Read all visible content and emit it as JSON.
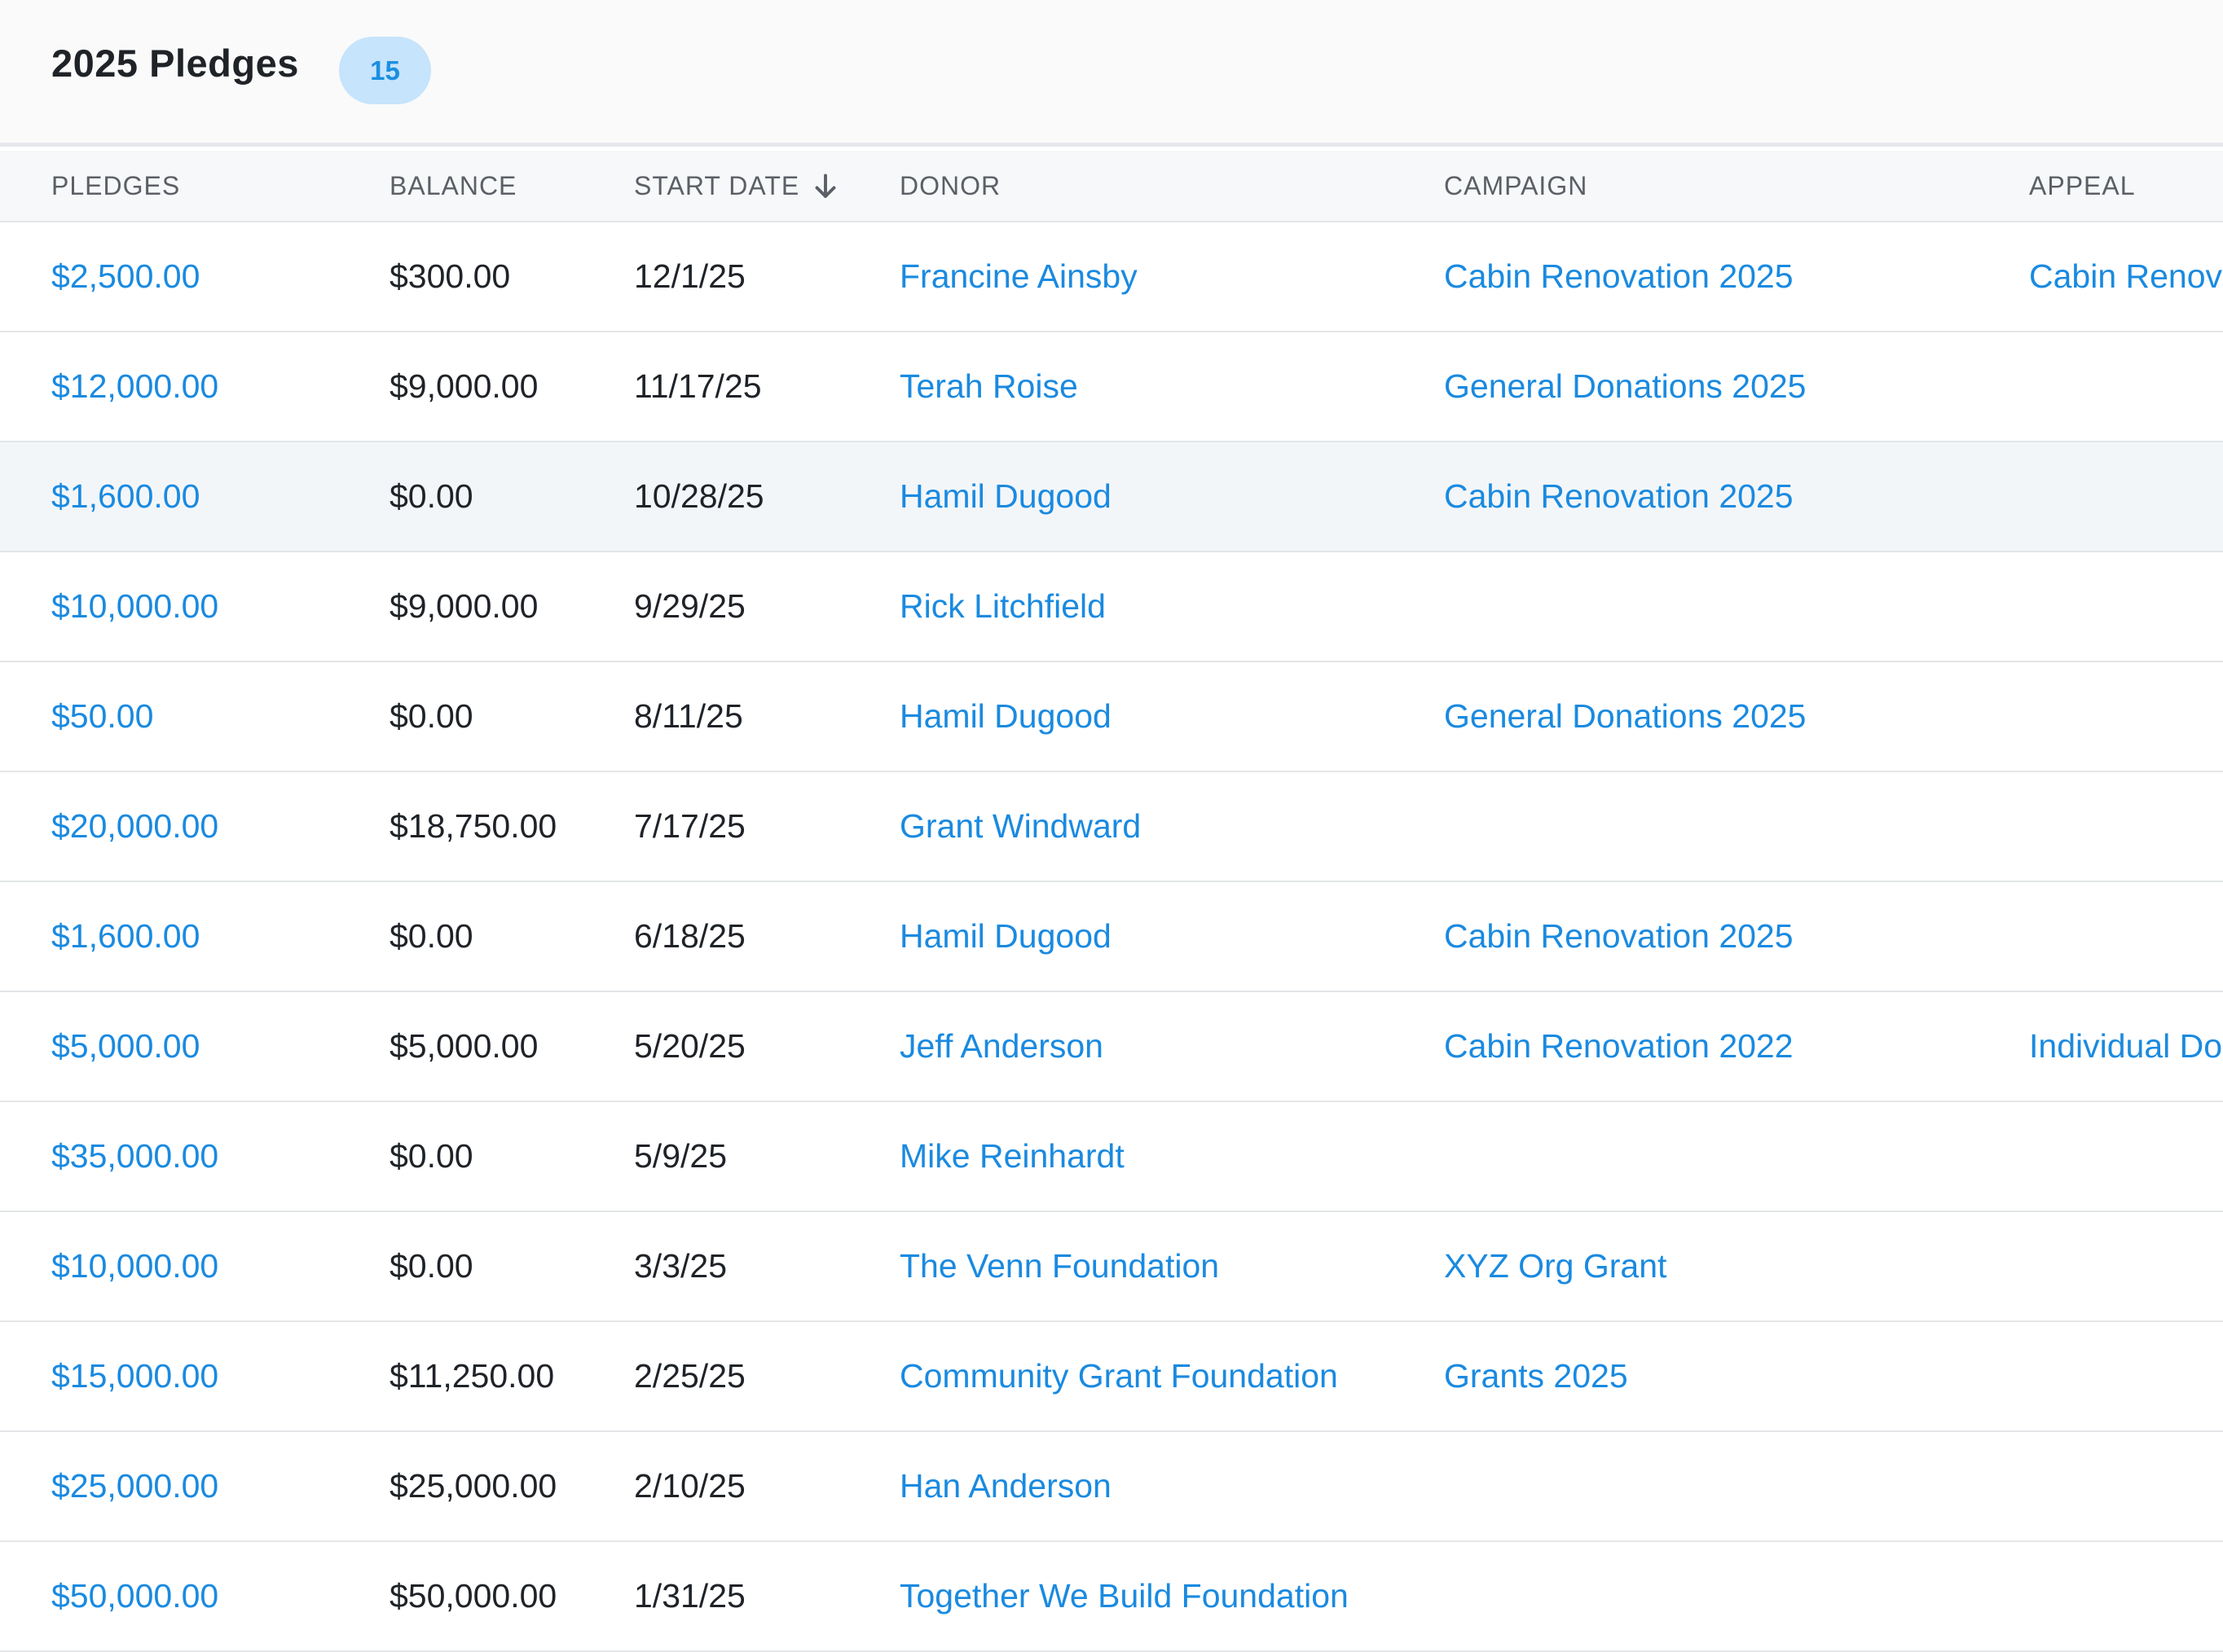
{
  "header": {
    "title": "2025 Pledges",
    "count": "15"
  },
  "columns": {
    "pledges": "PLEDGES",
    "balance": "BALANCE",
    "start_date": "START DATE",
    "donor": "DONOR",
    "campaign": "CAMPAIGN",
    "appeal": "APPEAL"
  },
  "sort": {
    "column": "start_date",
    "direction": "descending",
    "icon": "arrow-down-icon"
  },
  "colors": {
    "link": "#1a8ae0",
    "badge_bg": "#c6e4fb",
    "badge_text": "#1b8fe0",
    "highlight_row": "#f3f6f9"
  },
  "rows": [
    {
      "pledge": "$2,500.00",
      "balance": "$300.00",
      "start_date": "12/1/25",
      "donor": "Francine Ainsby",
      "campaign": "Cabin Renovation 2025",
      "appeal": "Cabin Renov"
    },
    {
      "pledge": "$12,000.00",
      "balance": "$9,000.00",
      "start_date": "11/17/25",
      "donor": "Terah Roise",
      "campaign": "General Donations 2025",
      "appeal": ""
    },
    {
      "pledge": "$1,600.00",
      "balance": "$0.00",
      "start_date": "10/28/25",
      "donor": "Hamil Dugood",
      "campaign": "Cabin Renovation 2025",
      "appeal": "",
      "highlighted": true
    },
    {
      "pledge": "$10,000.00",
      "balance": "$9,000.00",
      "start_date": "9/29/25",
      "donor": "Rick Litchfield",
      "campaign": "",
      "appeal": ""
    },
    {
      "pledge": "$50.00",
      "balance": "$0.00",
      "start_date": "8/11/25",
      "donor": "Hamil Dugood",
      "campaign": "General Donations 2025",
      "appeal": ""
    },
    {
      "pledge": "$20,000.00",
      "balance": "$18,750.00",
      "start_date": "7/17/25",
      "donor": "Grant Windward",
      "campaign": "",
      "appeal": ""
    },
    {
      "pledge": "$1,600.00",
      "balance": "$0.00",
      "start_date": "6/18/25",
      "donor": "Hamil Dugood",
      "campaign": "Cabin Renovation 2025",
      "appeal": ""
    },
    {
      "pledge": "$5,000.00",
      "balance": "$5,000.00",
      "start_date": "5/20/25",
      "donor": "Jeff Anderson",
      "campaign": "Cabin Renovation 2022",
      "appeal": "Individual Do"
    },
    {
      "pledge": "$35,000.00",
      "balance": "$0.00",
      "start_date": "5/9/25",
      "donor": "Mike Reinhardt",
      "campaign": "",
      "appeal": ""
    },
    {
      "pledge": "$10,000.00",
      "balance": "$0.00",
      "start_date": "3/3/25",
      "donor": "The Venn Foundation",
      "campaign": "XYZ Org Grant",
      "appeal": ""
    },
    {
      "pledge": "$15,000.00",
      "balance": "$11,250.00",
      "start_date": "2/25/25",
      "donor": "Community Grant Foundation",
      "campaign": "Grants 2025",
      "appeal": ""
    },
    {
      "pledge": "$25,000.00",
      "balance": "$25,000.00",
      "start_date": "2/10/25",
      "donor": "Han Anderson",
      "campaign": "",
      "appeal": ""
    },
    {
      "pledge": "$50,000.00",
      "balance": "$50,000.00",
      "start_date": "1/31/25",
      "donor": "Together We Build Foundation",
      "campaign": "",
      "appeal": ""
    }
  ]
}
